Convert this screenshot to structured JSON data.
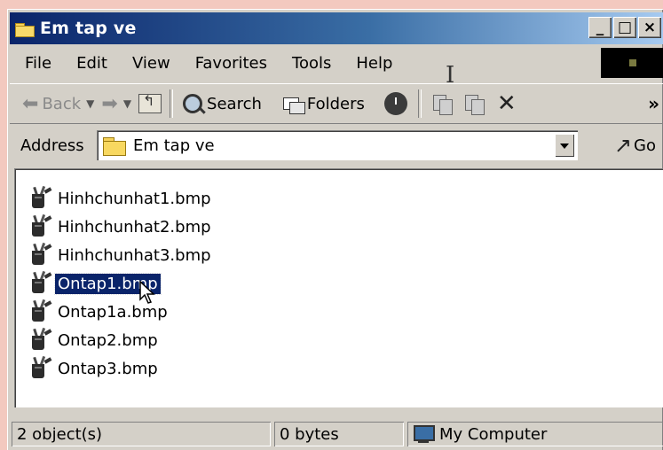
{
  "window": {
    "title": "Em tap ve",
    "controls": [
      "_",
      "□",
      "×"
    ]
  },
  "menubar": {
    "items": [
      "File",
      "Edit",
      "View",
      "Favorites",
      "Tools",
      "Help"
    ]
  },
  "toolbar": {
    "back_label": "Back",
    "search_label": "Search",
    "folders_label": "Folders",
    "overflow": "»"
  },
  "addressbar": {
    "label": "Address",
    "value": "Em tap ve",
    "go_label": "Go"
  },
  "files": [
    {
      "name": "Hinhchunhat1.bmp",
      "selected": false
    },
    {
      "name": "Hinhchunhat2.bmp",
      "selected": false
    },
    {
      "name": "Hinhchunhat3.bmp",
      "selected": false
    },
    {
      "name": "Ontap1.bmp",
      "selected": true
    },
    {
      "name": "Ontap1a.bmp",
      "selected": false
    },
    {
      "name": "Ontap2.bmp",
      "selected": false
    },
    {
      "name": "Ontap3.bmp",
      "selected": false
    }
  ],
  "statusbar": {
    "objects": "2 object(s)",
    "size": "0 bytes",
    "location": "My Computer"
  },
  "colors": {
    "titlebar_start": "#0a246a",
    "titlebar_end": "#a6caf0",
    "selection": "#0a246a",
    "chrome": "#d4d0c8"
  }
}
